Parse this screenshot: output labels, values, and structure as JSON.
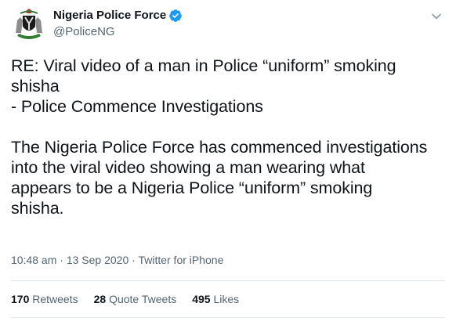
{
  "author": {
    "display_name": "Nigeria Police Force",
    "handle": "@PoliceNG",
    "verified_icon": "verified-badge-icon",
    "avatar_icon": "nigeria-coat-of-arms"
  },
  "tweet": {
    "text": "RE: Viral video of a man in Police “uniform” smoking\nshisha\n- Police Commence Investigations\n\nThe Nigeria Police Force has commenced investigations\ninto the viral video showing a man wearing what\nappears to be a Nigeria Police “uniform” smoking\nshisha.",
    "time": "10:48 am",
    "date": "13 Sep 2020",
    "source": "Twitter for iPhone"
  },
  "stats": {
    "retweets_count": "170",
    "retweets_label": "Retweets",
    "quote_count": "28",
    "quote_label": "Quote Tweets",
    "likes_count": "495",
    "likes_label": "Likes"
  },
  "colors": {
    "text": "#0f1419",
    "secondary": "#536471",
    "verified": "#1d9bf0",
    "divider": "#e1e8ed"
  }
}
